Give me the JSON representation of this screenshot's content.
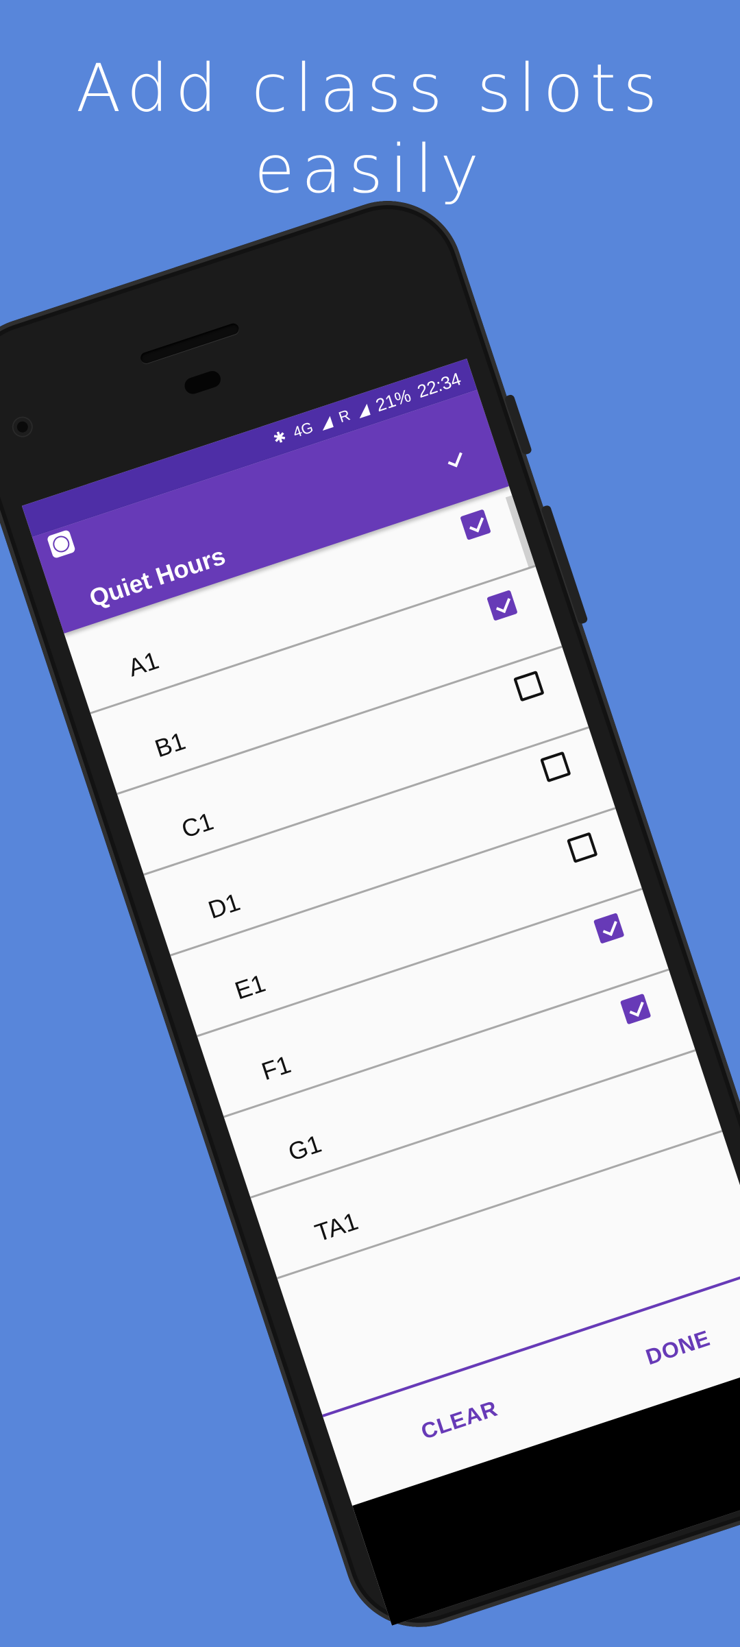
{
  "headline": {
    "line1": "Add class slots",
    "line2": "easily"
  },
  "status_bar": {
    "network": "4G",
    "roaming": "R",
    "battery": "21%",
    "time": "22:34"
  },
  "app": {
    "title": "Quiet Hours"
  },
  "slots": [
    {
      "label": "A1",
      "checked": true
    },
    {
      "label": "B1",
      "checked": true
    },
    {
      "label": "C1",
      "checked": false
    },
    {
      "label": "D1",
      "checked": false
    },
    {
      "label": "E1",
      "checked": false
    },
    {
      "label": "F1",
      "checked": true
    },
    {
      "label": "G1",
      "checked": true
    },
    {
      "label": "TA1",
      "checked": false
    }
  ],
  "first_row_checked": true,
  "actions": {
    "clear": "CLEAR",
    "done": "DONE"
  },
  "colors": {
    "background": "#5886da",
    "primary": "#673ab7",
    "primary_dark": "#4e2ea6"
  },
  "icons": [
    "bluetooth-icon",
    "signal-icon",
    "app-icon"
  ]
}
